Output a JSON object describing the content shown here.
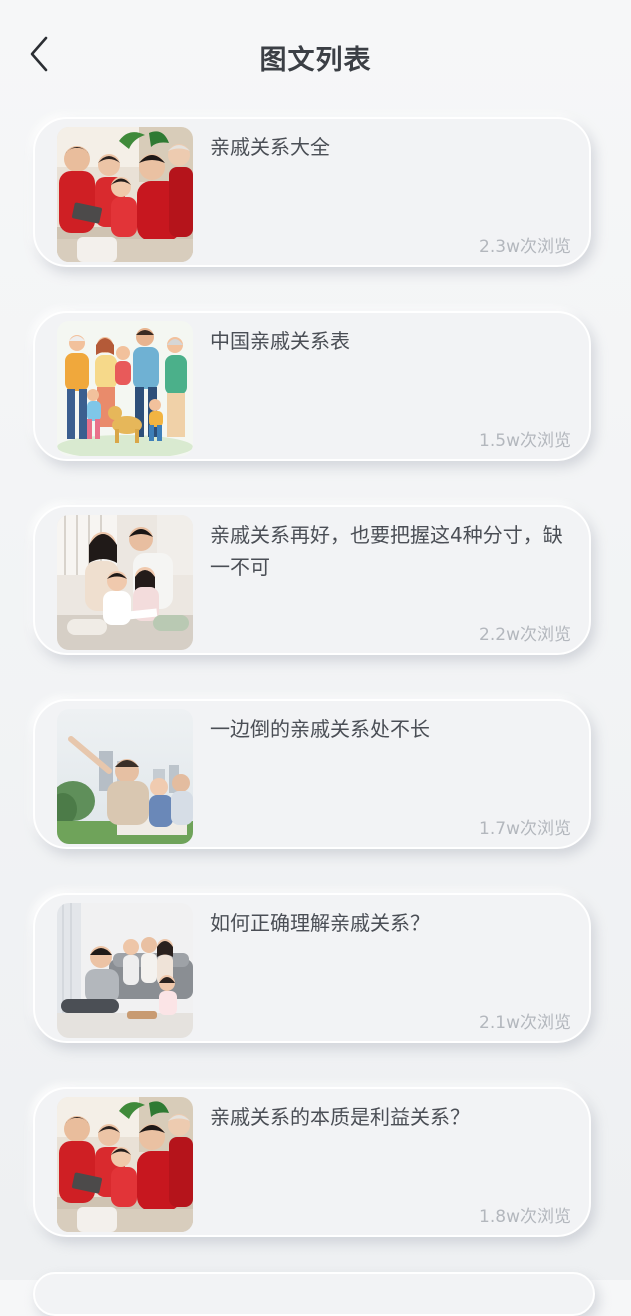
{
  "header": {
    "title": "图文列表"
  },
  "articles": [
    {
      "title": "亲戚关系大全",
      "views": "2.3w次浏览",
      "image": "family-red-new-year-photo"
    },
    {
      "title": "中国亲戚关系表",
      "views": "1.5w次浏览",
      "image": "family-illustration-with-dog"
    },
    {
      "title": "亲戚关系再好，也要把握这4种分寸，缺一不可",
      "views": "2.2w次浏览",
      "image": "family-reading-photo"
    },
    {
      "title": "一边倒的亲戚关系处不长",
      "views": "1.7w次浏览",
      "image": "family-outdoor-pointing-photo"
    },
    {
      "title": "如何正确理解亲戚关系？",
      "views": "2.1w次浏览",
      "image": "family-living-room-photo"
    },
    {
      "title": "亲戚关系的本质是利益关系？",
      "views": "1.8w次浏览",
      "image": "family-red-new-year-photo"
    }
  ]
}
